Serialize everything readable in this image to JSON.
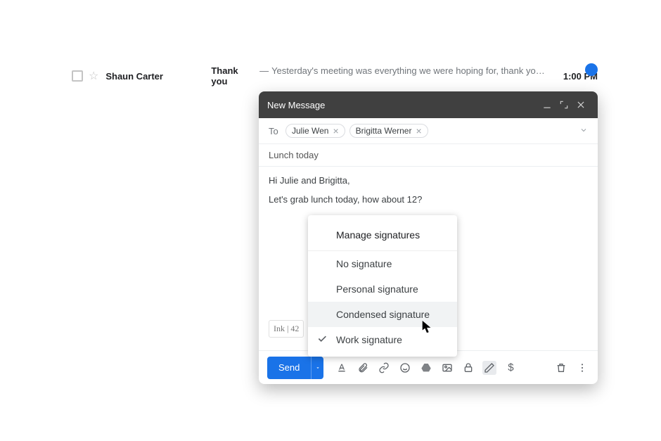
{
  "inbox": {
    "sender": "Shaun Carter",
    "subject": "Thank you",
    "snippet": "Yesterday's meeting was everything we were hoping for, thank you...",
    "time": "1:00 PM"
  },
  "compose": {
    "title": "New Message",
    "to_label": "To",
    "recipients": [
      "Julie Wen",
      "Brigitta Werner"
    ],
    "subject": "Lunch today",
    "body": {
      "line1": "Hi Julie and Brigitta,",
      "line2": "Let's grab lunch today, how about 12?"
    },
    "signature_quote": "Ink | 42",
    "send_label": "Send"
  },
  "signature_menu": {
    "header": "Manage signatures",
    "items": [
      {
        "label": "No signature",
        "selected": false
      },
      {
        "label": "Personal signature",
        "selected": false
      },
      {
        "label": "Condensed signature",
        "selected": false,
        "hovered": true
      },
      {
        "label": "Work signature",
        "selected": true
      }
    ]
  },
  "icons": {
    "minimize": "minimize",
    "fullscreen": "fullscreen",
    "close": "close",
    "expand_recipients": "expand",
    "format": "format",
    "attach": "attach",
    "link": "link",
    "emoji": "emoji",
    "drive": "drive",
    "photo": "photo",
    "confidential": "confidential",
    "pen": "pen",
    "dollar": "$",
    "trash": "trash",
    "more": "more"
  }
}
